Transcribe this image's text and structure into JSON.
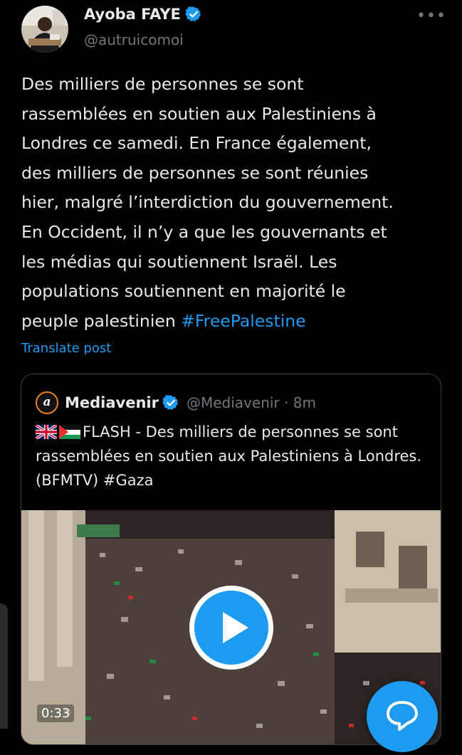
{
  "post": {
    "author_name": "Ayoba FAYE",
    "author_handle": "@autruicomoi",
    "more_icon": "more-horizontal-icon",
    "text": "Des milliers de personnes se sont\nrassemblées en soutien aux Palestiniens à\nLondres ce samedi. En France également,\ndes milliers de personnes se sont réunies\nhier, malgré l’interdiction du gouvernement.\nEn Occident, il n’y a que les gouvernants et\nles médias qui soutiennent Israël. Les\npopulations soutiennent en majorité le\npeuple palestinien ",
    "hashtag": "#FreePalestine",
    "translate_label": "Translate post"
  },
  "quote": {
    "logo_letter": "a",
    "name": "Mediavenir",
    "meta": "@Mediavenir · 8m",
    "text": "FLASH - Des milliers de personnes se\nsont rassemblées en soutien aux Palestiniens à\nLondres. (BFMTV) #Gaza",
    "flags": [
      "uk-flag",
      "palestine-flag"
    ],
    "video": {
      "duration": "0:33",
      "play_icon": "play-icon"
    }
  },
  "fab_icon": "reply-bubble-icon",
  "colors": {
    "background": "#000000",
    "text": "#e7e9ea",
    "secondary": "#71767b",
    "accent": "#1d9bf0",
    "border": "#3a3f45"
  }
}
